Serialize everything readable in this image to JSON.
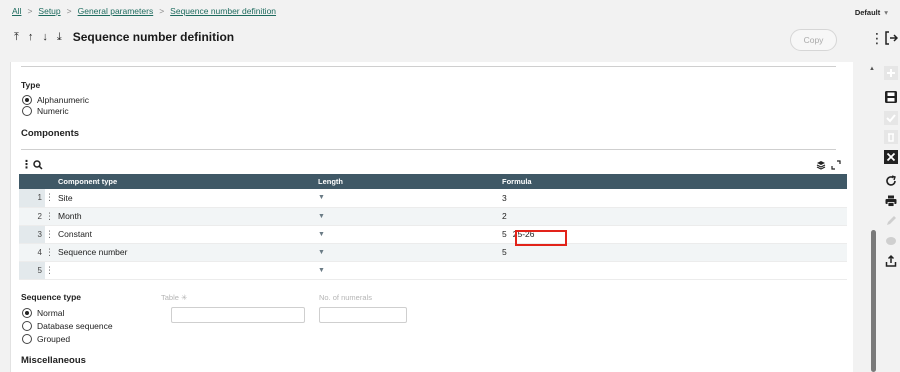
{
  "breadcrumb": [
    "All",
    "Setup",
    "General parameters",
    "Sequence number definition"
  ],
  "breadcrumb_sep": ">",
  "folder": {
    "label": "Default",
    "caret": "▾"
  },
  "header": {
    "title": "Sequence number definition",
    "copy_label": "Copy",
    "more_glyph": "⋮"
  },
  "type_section": {
    "label": "Type",
    "options": [
      {
        "label": "Alphanumeric",
        "selected": true
      },
      {
        "label": "Numeric",
        "selected": false
      }
    ]
  },
  "components_section": {
    "title": "Components"
  },
  "grid": {
    "columns": [
      "Component type",
      "Length",
      "Formula"
    ],
    "rows": [
      {
        "num": "1",
        "type": "Site",
        "length": "",
        "formula": "3"
      },
      {
        "num": "2",
        "type": "Month",
        "length": "",
        "formula": "2"
      },
      {
        "num": "3",
        "type": "Constant",
        "length": "",
        "formula": "5",
        "formula_value": "25-26"
      },
      {
        "num": "4",
        "type": "Sequence number",
        "length": "",
        "formula": "5"
      },
      {
        "num": "5",
        "type": "",
        "length": "",
        "formula": ""
      }
    ]
  },
  "sequence_type": {
    "label": "Sequence type",
    "options": [
      {
        "label": "Normal",
        "selected": true
      },
      {
        "label": "Database sequence",
        "selected": false
      },
      {
        "label": "Grouped",
        "selected": false
      }
    ],
    "table_label": "Table",
    "table_required_mark": "✳",
    "numerals_label": "No. of numerals"
  },
  "misc_section": {
    "title": "Miscellaneous"
  },
  "colors": {
    "grid_header": "#3f5866",
    "link": "#1d6b5e",
    "highlight": "#e2231a"
  },
  "sidebar_icons": [
    "add-icon",
    "save-icon",
    "check-icon",
    "delete-icon",
    "close-icon",
    "refresh-icon",
    "print-icon",
    "edit-icon",
    "comment-icon",
    "export-icon"
  ]
}
